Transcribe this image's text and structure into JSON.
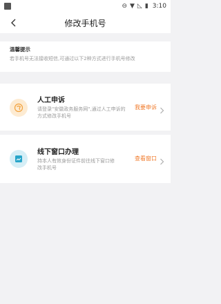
{
  "status_bar": {
    "time": "3:10",
    "icons": [
      "record-icon",
      "wifi-icon",
      "signal-off-icon",
      "battery-icon"
    ]
  },
  "nav": {
    "title": "修改手机号",
    "back_icon": "chevron-left-icon"
  },
  "tip": {
    "title": "温馨提示",
    "text": "若手机号无法接收短信,可通过以下2种方式进行手机号修改"
  },
  "options": [
    {
      "icon": "appeal-icon",
      "title": "人工申诉",
      "desc": "请登录\"安徽政务服务网\",通过人工申诉的方式修改手机号",
      "action": "我要申诉"
    },
    {
      "icon": "window-icon",
      "title": "线下窗口办理",
      "desc": "持本人有效身份证件前往线下窗口修改手机号",
      "action": "查看窗口"
    }
  ],
  "colors": {
    "accent": "#f07b2c",
    "page_bg": "#f2f2f4",
    "appeal_icon_bg": "#fdebd2",
    "window_icon_bg": "#d5eef6"
  }
}
